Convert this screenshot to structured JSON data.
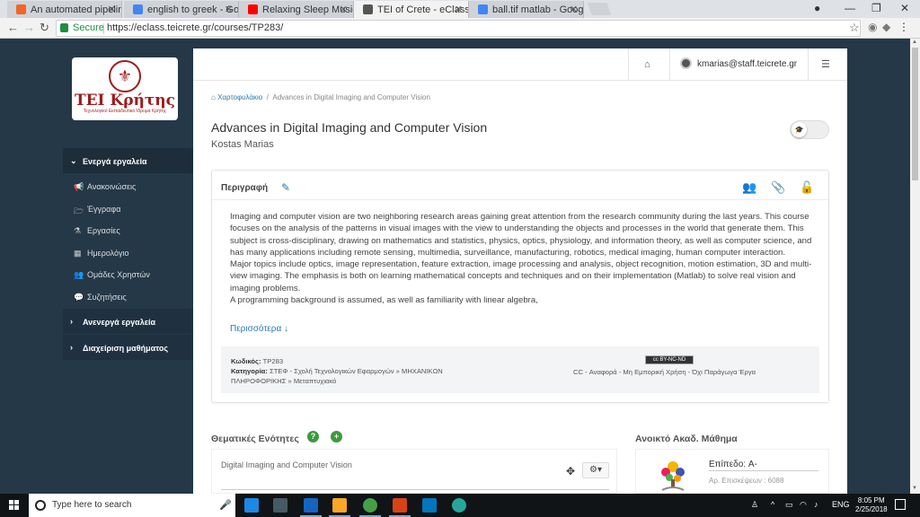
{
  "browser": {
    "tabs": [
      {
        "title": "An automated pipeline f",
        "favicon_color": "#f26522",
        "active": false
      },
      {
        "title": "english to greek - Googl",
        "favicon_color": "#4285f4",
        "active": false
      },
      {
        "title": "Relaxing Sleep Music",
        "favicon_color": "#ff0000",
        "active": false
      },
      {
        "title": "TEI of Crete - eClass | Ad",
        "favicon_color": "#555555",
        "active": true
      },
      {
        "title": "ball.tif matlab - Google S",
        "favicon_color": "#4285f4",
        "active": false
      }
    ],
    "secure_label": "Secure",
    "url": "https://eclass.teicrete.gr/courses/TP283/"
  },
  "logo": {
    "title": "ΤΕΙ Κρήτης",
    "subtitle": "Τεχνολογικό Εκπαιδευτικό Ίδρυμα Κρήτης"
  },
  "sidebar": {
    "active_group": "Ενεργά εργαλεία",
    "items": [
      {
        "label": "Ανακοινώσεις",
        "icon": "megaphone-icon",
        "glyph": "📢"
      },
      {
        "label": "Έγγραφα",
        "icon": "folder-icon",
        "glyph": "🗁"
      },
      {
        "label": "Εργασίες",
        "icon": "flask-icon",
        "glyph": "⚗"
      },
      {
        "label": "Ημερολόγιο",
        "icon": "calendar-icon",
        "glyph": "▦"
      },
      {
        "label": "Ομάδες Χρηστών",
        "icon": "users-icon",
        "glyph": "👥"
      },
      {
        "label": "Συζητήσεις",
        "icon": "comments-icon",
        "glyph": "💬"
      }
    ],
    "inactive_group": "Ανενεργά εργαλεία",
    "admin_group": "Διαχείριση μαθήματος"
  },
  "header": {
    "user": "kmarias@staff.teicrete.gr"
  },
  "breadcrumb": {
    "home": "Χαρτοφυλάκιο",
    "separator": "/",
    "current": "Advances in Digital Imaging and Computer Vision"
  },
  "course": {
    "title": "Advances in Digital Imaging and Computer Vision",
    "author": "Kostas Marias"
  },
  "description": {
    "heading": "Περιγραφή",
    "paragraphs": [
      "Imaging and computer vision are two neighboring research areas gaining great attention from the research community during the last years. This course focuses on the analysis of the patterns in visual images with the view to understanding the objects and processes in the world that generate them. This subject is cross-disciplinary, drawing on mathematics and statistics, physics, optics, physiology, and information theory, as well as computer science, and has many applications including remote sensing, multimedia, surveillance, manufacturing, robotics, medical imaging, human computer interaction.",
      "Major topics include optics, image representation, feature extraction, image processing and analysis, object recognition, motion estimation, 3D and multi-view imaging. The emphasis is both on learning mathematical concepts and techniques and on their implementation (Matlab) to solve real vision and imaging problems.",
      "A programming background is assumed, as well as familiarity with linear algebra,"
    ],
    "more": "Περισσότερα"
  },
  "meta": {
    "code_label": "Κωδικός:",
    "code": "TP283",
    "category_label": "Κατηγορία:",
    "category": "ΣΤΕΦ - Σχολή Τεχνολογικών Εφαρμογών » ΜΗΧΑΝΙΚΩΝ ΠΛΗΡΟΦΟΡΙΚΗΣ » Μεταπτυχιακό",
    "license_badge": "cc BY-NC-ND",
    "license": "CC - Αναφορά - Μη Εμπορική Χρήση - Όχι Παράγωγα Έργα"
  },
  "units": {
    "heading": "Θεματικές Ενότητες",
    "first_unit": "Digital Imaging and Computer Vision"
  },
  "open_course": {
    "heading": "Ανοικτό Ακαδ. Μάθημα",
    "level": "Επίπεδο: A-",
    "visits": "Αρ. Επισκέψεων : 6088"
  },
  "taskbar": {
    "search_placeholder": "Type here to search",
    "language": "ENG",
    "time": "8:05 PM",
    "date": "2/25/2018"
  }
}
